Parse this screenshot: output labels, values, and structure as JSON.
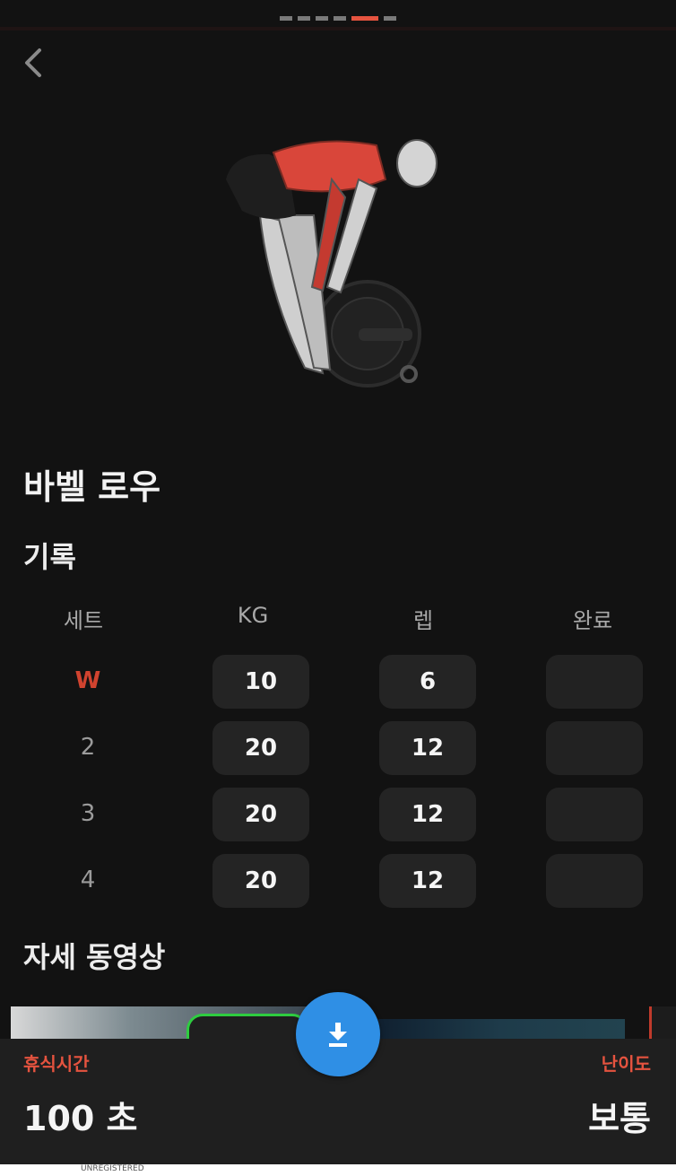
{
  "pager": {
    "count": 6,
    "active_index": 4
  },
  "exercise": {
    "title": "바벨 로우"
  },
  "record": {
    "section_title": "기록",
    "headers": [
      "세트",
      "KG",
      "렙",
      "완료"
    ],
    "rows": [
      {
        "set": "W",
        "kg": "10",
        "rep": "6",
        "done": ""
      },
      {
        "set": "2",
        "kg": "20",
        "rep": "12",
        "done": ""
      },
      {
        "set": "3",
        "kg": "20",
        "rep": "12",
        "done": ""
      },
      {
        "set": "4",
        "kg": "20",
        "rep": "12",
        "done": ""
      }
    ]
  },
  "video": {
    "section_title": "자세 동영상"
  },
  "bottom_bar": {
    "rest_label": "휴식시간",
    "rest_value": "100 초",
    "difficulty_label": "난이도",
    "difficulty_value": "보통"
  },
  "fab": {
    "icon": "download-icon"
  },
  "footer": {
    "text": "UNREGISTERED"
  },
  "colors": {
    "accent": "#e5533f",
    "fab": "#2f8fe5",
    "background": "#121212",
    "cell": "#242424"
  }
}
